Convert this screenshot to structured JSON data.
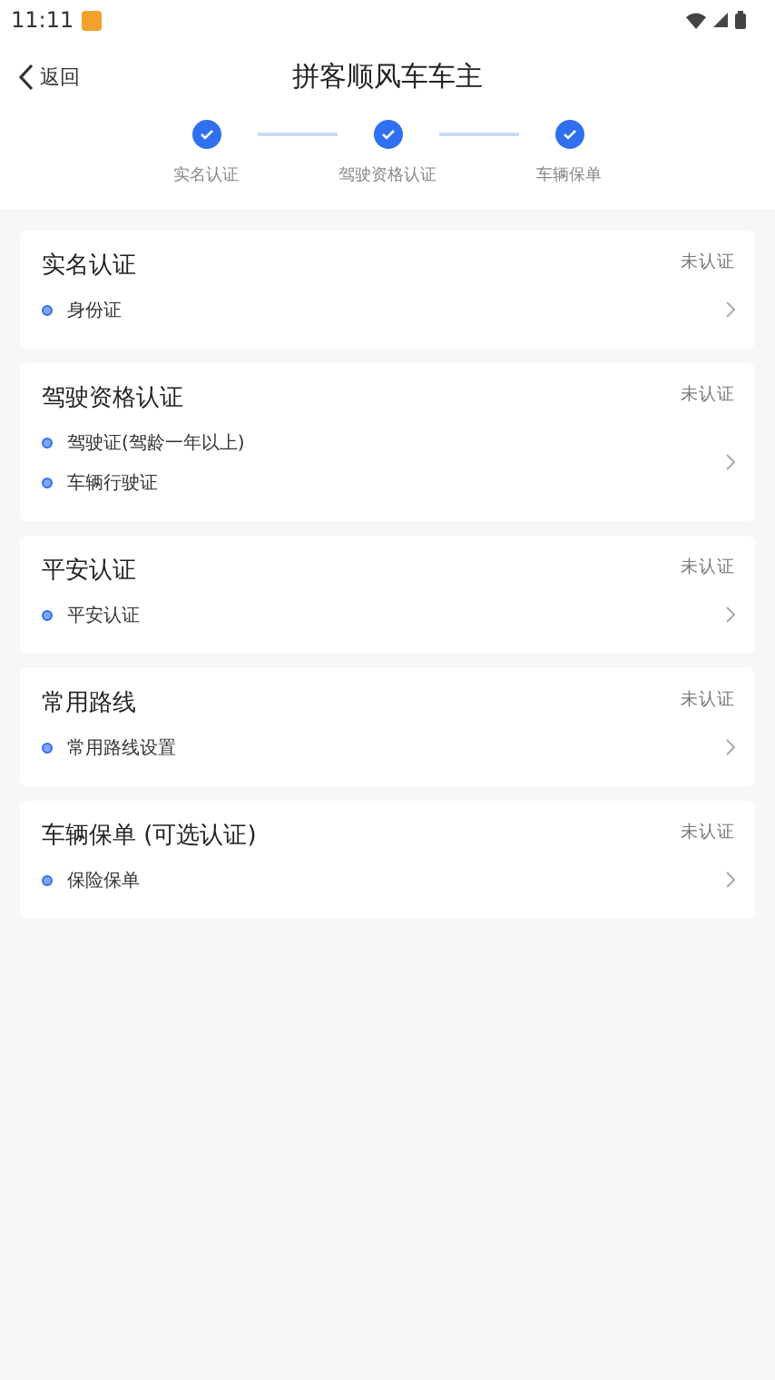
{
  "status_bar": {
    "time": "11:11"
  },
  "header": {
    "back": "返回",
    "title": "拼客顺风车车主"
  },
  "steps": [
    {
      "label": "实名认证",
      "done": true
    },
    {
      "label": "驾驶资格认证",
      "done": true
    },
    {
      "label": "车辆保单",
      "done": true
    }
  ],
  "cards": [
    {
      "title": "实名认证",
      "status": "未认证",
      "items": [
        "身份证"
      ]
    },
    {
      "title": "驾驶资格认证",
      "status": "未认证",
      "items": [
        "驾驶证(驾龄一年以上)",
        "车辆行驶证"
      ]
    },
    {
      "title": "平安认证",
      "status": "未认证",
      "items": [
        "平安认证"
      ]
    },
    {
      "title": "常用路线",
      "status": "未认证",
      "items": [
        "常用路线设置"
      ]
    },
    {
      "title": "车辆保单 (可选认证)",
      "status": "未认证",
      "items": [
        "保险保单"
      ]
    }
  ]
}
